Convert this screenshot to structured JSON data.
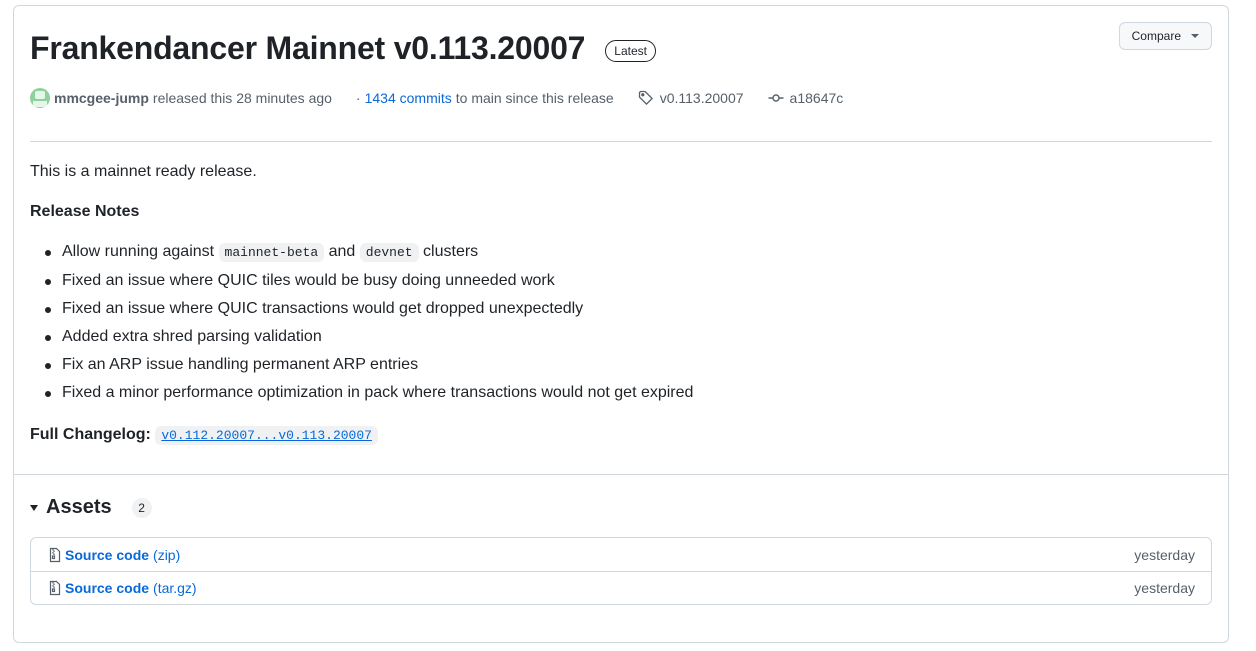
{
  "release": {
    "title": "Frankendancer Mainnet v0.113.20007",
    "badge": "Latest",
    "compare_label": "Compare",
    "author": "mmcgee-jump",
    "released_text": "released this 28 minutes ago",
    "commits_dot": "·",
    "commits_link": "1434 commits",
    "commits_suffix": "to main since this release",
    "tag": "v0.113.20007",
    "commit": "a18647c"
  },
  "body": {
    "intro": "This is a mainnet ready release.",
    "notes_heading": "Release Notes",
    "note1_prefix": "Allow running against",
    "note1_code1": "mainnet-beta",
    "note1_and": "and",
    "note1_code2": "devnet",
    "note1_suffix": "clusters",
    "notes": [
      "Fixed an issue where QUIC tiles would be busy doing unneeded work",
      "Fixed an issue where QUIC transactions would get dropped unexpectedly",
      "Added extra shred parsing validation",
      "Fix an ARP issue handling permanent ARP entries",
      "Fixed a minor performance optimization in pack where transactions would not get expired"
    ],
    "changelog_label": "Full Changelog:",
    "changelog_link": "v0.112.20007...v0.113.20007"
  },
  "assets": {
    "title": "Assets",
    "count": "2",
    "items": [
      {
        "name": "Source code",
        "ext": "(zip)",
        "date": "yesterday",
        "icon": "file-zip-icon"
      },
      {
        "name": "Source code",
        "ext": "(tar.gz)",
        "date": "yesterday",
        "icon": "file-zip-icon"
      }
    ]
  },
  "colors": {
    "link": "#0969da",
    "text": "#1f2328",
    "muted": "#57606a",
    "border": "#d0d7de"
  }
}
